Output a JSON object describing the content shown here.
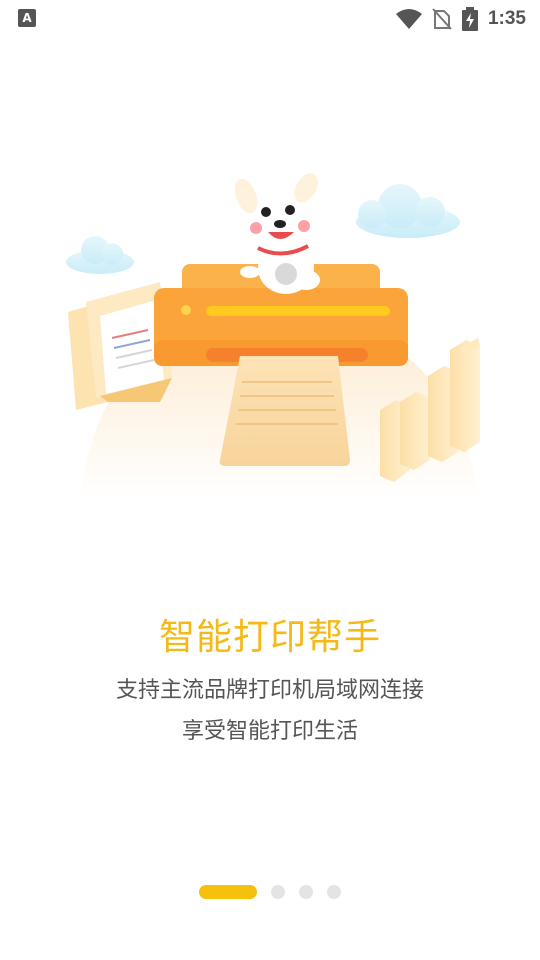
{
  "status_bar": {
    "app_badge": "A",
    "time": "1:35",
    "icons": [
      "wifi-icon",
      "no-sim-icon",
      "battery-charging-icon"
    ]
  },
  "onboarding": {
    "title": "智能打印帮手",
    "subtitle_line1": "支持主流品牌打印机局域网连接",
    "subtitle_line2": "享受智能打印生活"
  },
  "pager": {
    "total": 4,
    "active_index": 0
  },
  "colors": {
    "accent": "#f5b916",
    "text": "#555555",
    "dot_inactive": "#e4e4e4"
  }
}
